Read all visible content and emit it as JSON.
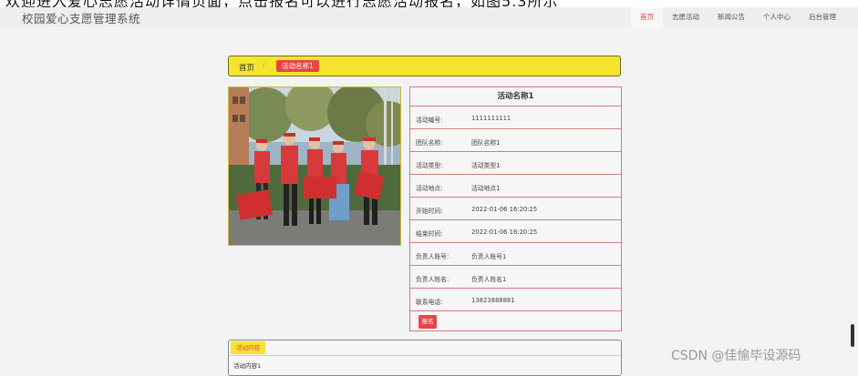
{
  "top_caption": "欢迎进入爱心志愿活动详情页面，点击报名可以进行志愿活动报名，如图5.3所示",
  "header": {
    "site_title": "校园爱心支愿管理系统",
    "nav": [
      "首页",
      "志愿活动",
      "新闻公告",
      "个人中心",
      "后台管理"
    ],
    "active_nav": "首页"
  },
  "breadcrumb": {
    "home": "首页",
    "separator": "/",
    "current": "活动名称1"
  },
  "detail": {
    "title": "活动名称1",
    "rows": [
      {
        "label": "活动编号:",
        "value": "1111111111"
      },
      {
        "label": "团队名称:",
        "value": "团队名称1"
      },
      {
        "label": "活动类型:",
        "value": "活动类型1"
      },
      {
        "label": "活动地点:",
        "value": "活动地点1"
      },
      {
        "label": "开始时间:",
        "value": "2022-01-06 16:20:25"
      },
      {
        "label": "结束时间:",
        "value": "2022-01-06 16:20:25"
      },
      {
        "label": "负责人账号:",
        "value": "负责人账号1"
      },
      {
        "label": "负责人姓名:",
        "value": "负责人姓名1"
      },
      {
        "label": "联系电话:",
        "value": "13823888881"
      }
    ],
    "apply_label": "报名"
  },
  "content": {
    "tab_label": "活动内容",
    "text": "活动内容1"
  },
  "watermark": "CSDN @佳愉毕设源码",
  "colors": {
    "accent_red": "#e84646",
    "accent_yellow": "#f5e52e",
    "border_red": "#d07d7d"
  }
}
